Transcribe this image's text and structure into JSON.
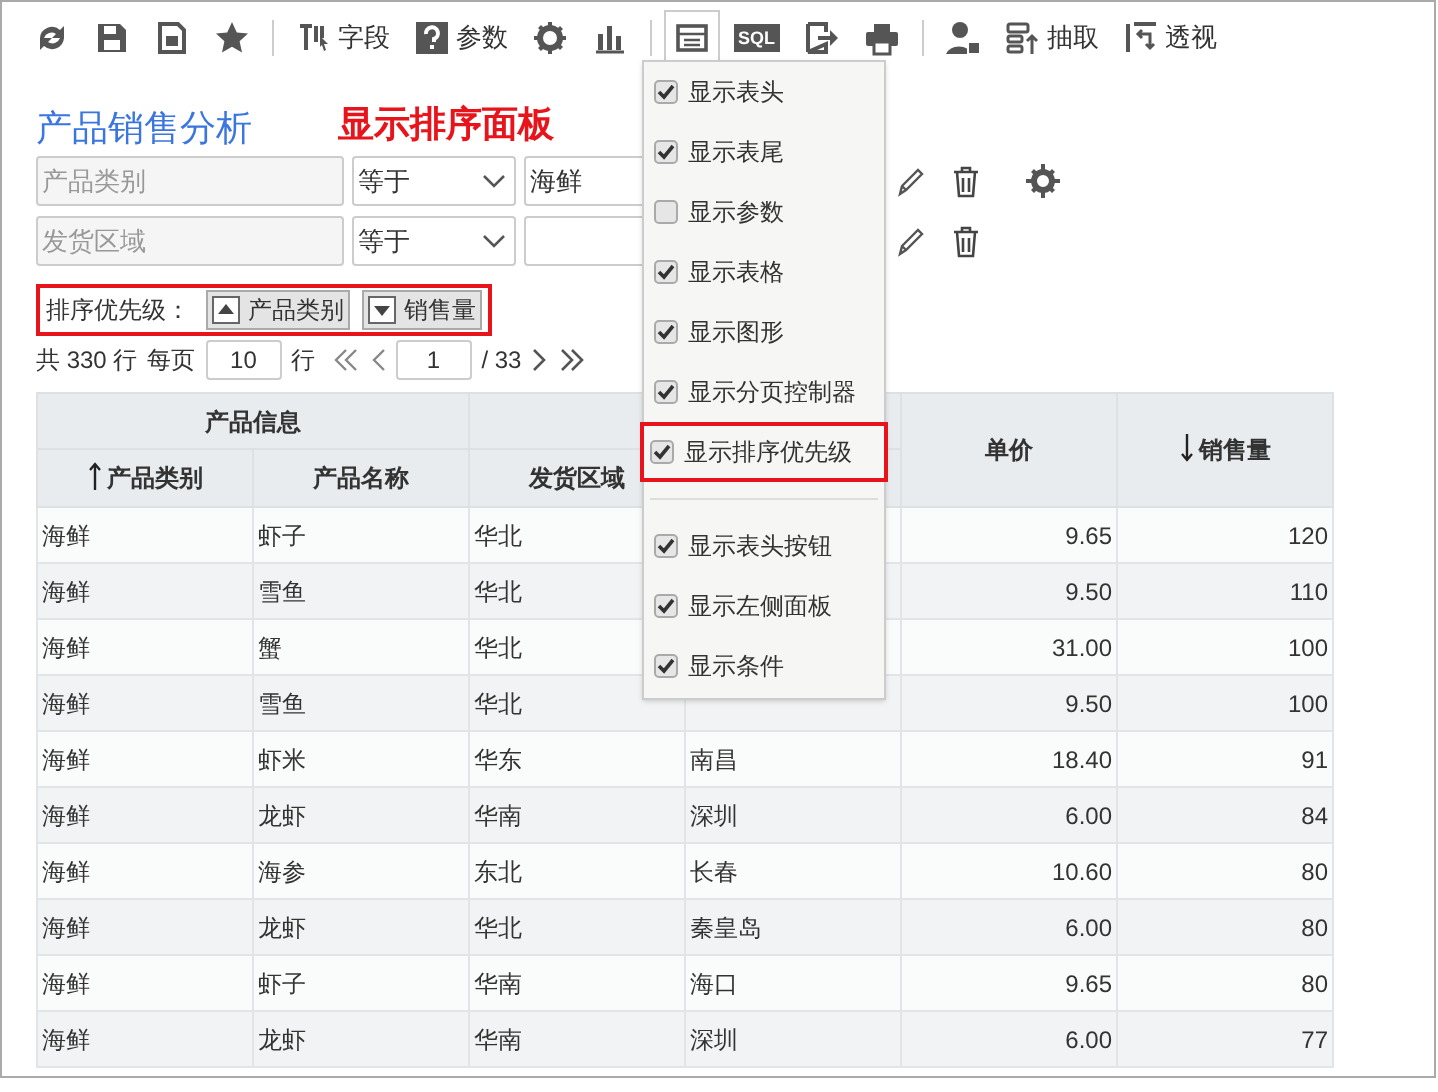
{
  "toolbar": [
    {
      "selected": false
    },
    {
      "selected": false
    },
    {
      "selected": false
    },
    {
      "selected": false
    },
    {
      "label": "字段",
      "selected": false
    },
    {
      "label": "参数",
      "selected": false
    },
    {
      "selected": false
    },
    {
      "selected": false
    },
    {
      "selected": true
    },
    {
      "label": "SQL",
      "selected": false
    },
    {
      "selected": false
    },
    {
      "selected": false
    },
    {
      "selected": false
    },
    {
      "label": "抽取",
      "selected": false
    },
    {
      "label": "透视",
      "selected": false
    }
  ],
  "title": "产品销售分析",
  "annotation": "显示排序面板",
  "filters": [
    {
      "field": "产品类别",
      "operator": "等于",
      "value": "海鲜",
      "settings": true
    },
    {
      "field": "发货区域",
      "operator": "等于",
      "settings": false
    }
  ],
  "sort_panel": {
    "label": "排序优先级：",
    "highlighted": true,
    "items": [
      {
        "label": "产品类别",
        "ascending": true
      },
      {
        "label": "销售量",
        "ascending": false
      }
    ]
  },
  "pager": {
    "total": "共 330 行",
    "per_page_label": "每页",
    "per_page": "10",
    "rows_label": "行",
    "page": "1",
    "pages": "/ 33"
  },
  "table": {
    "header_groups": [
      {
        "label": "产品信息"
      }
    ],
    "columns": [
      {
        "label": "产品类别",
        "kind": "text",
        "ascending": true
      },
      {
        "label": "产品名称",
        "kind": "text"
      },
      {
        "label": "发货区域",
        "kind": "text"
      },
      {
        "kind": "text"
      },
      {
        "label": "单价",
        "kind": "number"
      },
      {
        "label": "销售量",
        "kind": "number",
        "ascending": false
      }
    ],
    "rows": [
      [
        "海鲜",
        "虾子",
        "华北",
        null,
        "9.65",
        "120"
      ],
      [
        "海鲜",
        "雪鱼",
        "华北",
        null,
        "9.50",
        "110"
      ],
      [
        "海鲜",
        "蟹",
        "华北",
        null,
        "31.00",
        "100"
      ],
      [
        "海鲜",
        "雪鱼",
        "华北",
        null,
        "9.50",
        "100"
      ],
      [
        "海鲜",
        "虾米",
        "华东",
        "南昌",
        "18.40",
        "91"
      ],
      [
        "海鲜",
        "龙虾",
        "华南",
        "深圳",
        "6.00",
        "84"
      ],
      [
        "海鲜",
        "海参",
        "东北",
        "长春",
        "10.60",
        "80"
      ],
      [
        "海鲜",
        "龙虾",
        "华北",
        "秦皇岛",
        "6.00",
        "80"
      ],
      [
        "海鲜",
        "虾子",
        "华南",
        "海口",
        "9.65",
        "80"
      ],
      [
        "海鲜",
        "龙虾",
        "华南",
        "深圳",
        "6.00",
        "77"
      ]
    ]
  },
  "menu": {
    "groups": [
      [
        {
          "label": "显示表头",
          "checked": true,
          "highlighted": false
        },
        {
          "label": "显示表尾",
          "checked": true,
          "highlighted": false
        },
        {
          "label": "显示参数",
          "checked": false,
          "highlighted": false
        },
        {
          "label": "显示表格",
          "checked": true,
          "highlighted": false
        },
        {
          "label": "显示图形",
          "checked": true,
          "highlighted": false
        },
        {
          "label": "显示分页控制器",
          "checked": true,
          "highlighted": false
        },
        {
          "label": "显示排序优先级",
          "checked": true,
          "highlighted": true
        }
      ],
      [
        {
          "label": "显示表头按钮",
          "checked": true,
          "highlighted": false
        },
        {
          "label": "显示左侧面板",
          "checked": true,
          "highlighted": false
        },
        {
          "label": "显示条件",
          "checked": true,
          "highlighted": false
        }
      ]
    ]
  }
}
